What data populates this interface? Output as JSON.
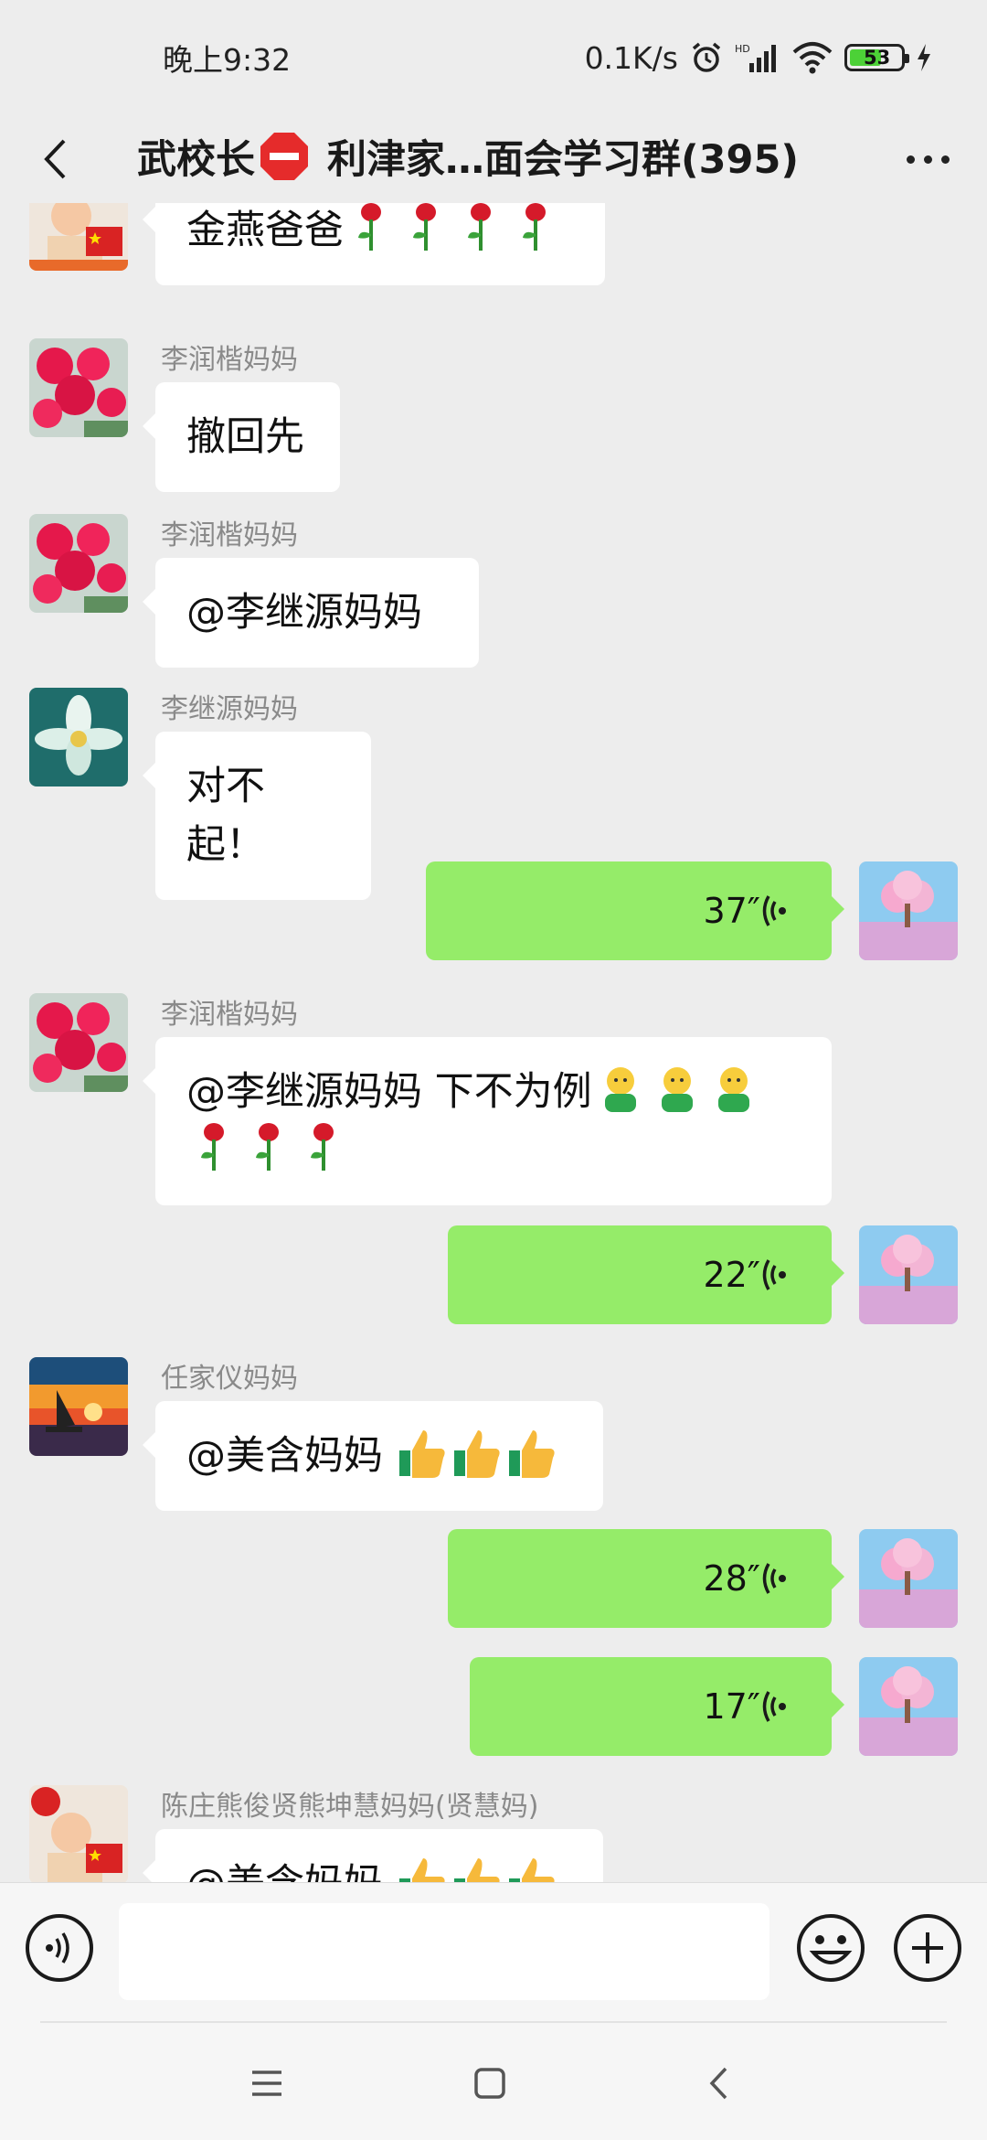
{
  "status_bar": {
    "time": "晚上9:32",
    "net_speed": "0.1K/s",
    "battery": "53"
  },
  "header": {
    "title_part1": "武校长",
    "title_part2": " 利津家…面会学习群(395)"
  },
  "messages": [
    {
      "type": "text",
      "side": "left",
      "sender": "",
      "avatar": "child-flag-avatar",
      "text": "金燕爸爸",
      "emoji": [
        "rose",
        "rose",
        "rose",
        "rose"
      ]
    },
    {
      "type": "text",
      "side": "left",
      "sender": "李润楷妈妈",
      "avatar": "red-flowers-avatar",
      "text": "撤回先"
    },
    {
      "type": "text",
      "side": "left",
      "sender": "李润楷妈妈",
      "avatar": "red-flowers-avatar",
      "text": "@李继源妈妈"
    },
    {
      "type": "text",
      "side": "left",
      "sender": "李继源妈妈",
      "avatar": "white-flower-avatar",
      "text": "对不起！"
    },
    {
      "type": "voice",
      "side": "right",
      "duration": "37″",
      "avatar": "pink-tree-avatar"
    },
    {
      "type": "text",
      "side": "left",
      "sender": "李润楷妈妈",
      "avatar": "red-flowers-avatar",
      "text": "@李继源妈妈  下不为例",
      "emoji": [
        "bowing-face",
        "bowing-face",
        "bowing-face",
        "rose",
        "rose",
        "rose"
      ]
    },
    {
      "type": "voice",
      "side": "right",
      "duration": "22″",
      "avatar": "pink-tree-avatar"
    },
    {
      "type": "text",
      "side": "left",
      "sender": "任家仪妈妈",
      "avatar": "sunset-sail-avatar",
      "text": "@美含妈妈 ",
      "emoji": [
        "thumbs-up",
        "thumbs-up",
        "thumbs-up"
      ]
    },
    {
      "type": "voice",
      "side": "right",
      "duration": "28″",
      "avatar": "pink-tree-avatar"
    },
    {
      "type": "voice",
      "side": "right",
      "duration": "17″",
      "avatar": "pink-tree-avatar"
    },
    {
      "type": "text",
      "side": "left",
      "sender": "陈庄熊俊贤熊坤慧妈妈(贤慧妈)",
      "avatar": "child-flag-avatar",
      "text": "@美含妈妈 ",
      "emoji": [
        "thumbs-up",
        "thumbs-up",
        "thumbs-up"
      ]
    }
  ],
  "input": {
    "placeholder": ""
  },
  "icons": {
    "back": "back-arrow-icon",
    "more": "more-dots-icon",
    "voice_toggle": "voice-input-icon",
    "emoji": "emoji-icon",
    "plus": "plus-icon",
    "nav_menu": "menu-icon",
    "nav_home": "home-icon",
    "nav_back": "back-icon"
  },
  "colors": {
    "background": "#ededed",
    "own_bubble": "#95ec69",
    "other_bubble": "#ffffff",
    "sender_name": "#8a8a8a"
  }
}
